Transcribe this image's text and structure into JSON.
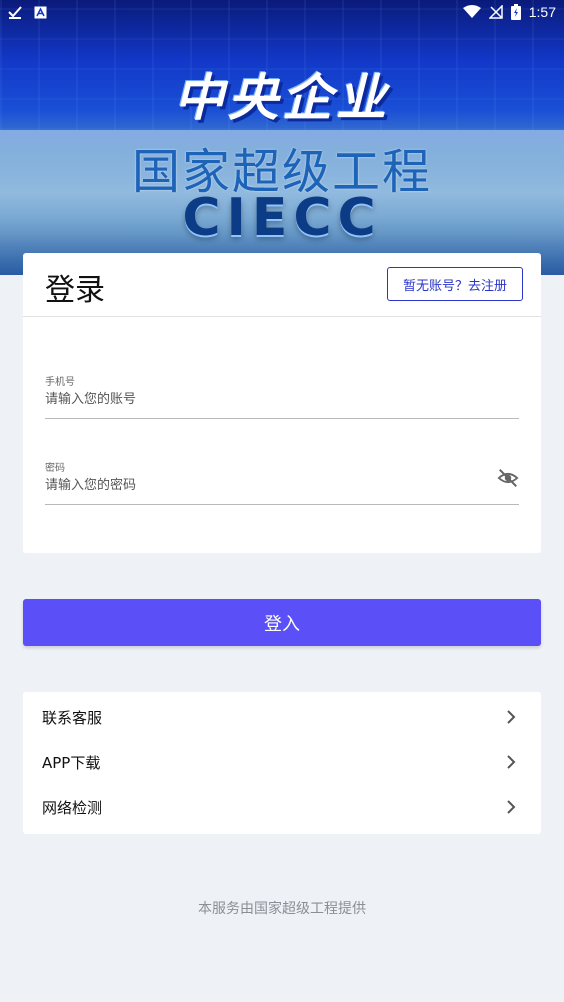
{
  "status_bar": {
    "time": "1:57"
  },
  "banner": {
    "line1": "中央企业",
    "line2": "国家超级工程",
    "line3": "CIECC"
  },
  "login": {
    "title": "登录",
    "register_label": "暂无账号？去注册",
    "phone": {
      "label": "手机号",
      "placeholder": "请输入您的账号",
      "value": ""
    },
    "password": {
      "label": "密码",
      "placeholder": "请输入您的密码",
      "value": ""
    },
    "submit_label": "登入"
  },
  "menu": {
    "items": [
      {
        "label": "联系客服"
      },
      {
        "label": "APP下载"
      },
      {
        "label": "网络检测"
      }
    ]
  },
  "footer": {
    "text": "本服务由国家超级工程提供"
  },
  "colors": {
    "primary": "#5b4ff7",
    "register_border": "#2b35c7",
    "background": "#eef2f7"
  }
}
